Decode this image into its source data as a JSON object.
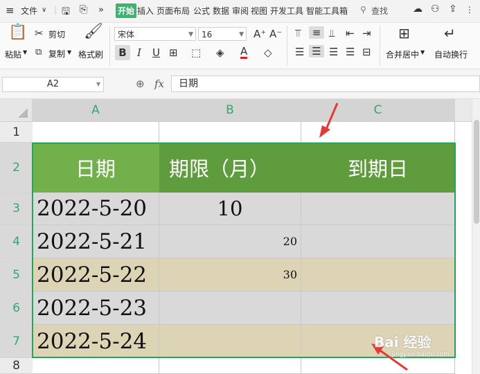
{
  "menubar": {
    "file_label": "文件",
    "tabs": [
      "开始",
      "插入",
      "页面布局",
      "公式",
      "数据",
      "审阅",
      "视图",
      "开发工具",
      "智能工具箱"
    ],
    "search_label": "查找"
  },
  "ribbon": {
    "paste_label": "粘贴",
    "cut_label": "剪切",
    "copy_label": "复制",
    "format_painter_label": "格式刷",
    "font_name": "宋体",
    "font_size": "16",
    "merge_center_label": "合并居中",
    "wrap_text_label": "自动换行",
    "font_color": "#e02020"
  },
  "formula_bar": {
    "cell_ref": "A2",
    "fx_label": "fx",
    "content": "日期"
  },
  "sheet": {
    "columns": [
      "A",
      "B",
      "C"
    ],
    "rows": [
      "1",
      "2",
      "3",
      "4",
      "5",
      "6",
      "7",
      "8"
    ],
    "header_row": [
      "日期",
      "期限（月）",
      "到期日"
    ],
    "dates": [
      "2022-5-20",
      "2022-5-21",
      "2022-5-22",
      "2022-5-23",
      "2022-5-24"
    ],
    "terms": [
      "10",
      "20",
      "30",
      "",
      ""
    ],
    "header_fill": "#5e9c3e",
    "header_fill_a": "#72b04c",
    "band_gray": "#d9d9d9",
    "band_tan": "#ddd3b5",
    "selection_color": "#1fa85b"
  },
  "watermark": {
    "text": "Bai 经验",
    "sub": "jingyan.baidu.com"
  }
}
